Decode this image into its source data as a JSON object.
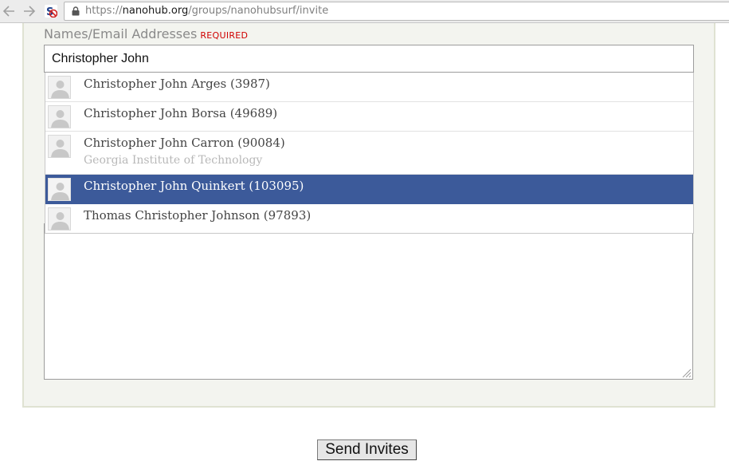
{
  "browser": {
    "url_scheme": "https://",
    "url_host": "nanohub.org",
    "url_path": "/groups/nanohubsurf/invite"
  },
  "form": {
    "label": "Names/Email Addresses",
    "required_label": "REQUIRED",
    "names_value": "Christopher John",
    "submit_label": "Send Invites"
  },
  "suggestions": [
    {
      "name": "Christopher John Arges (3987)",
      "org": "",
      "selected": false
    },
    {
      "name": "Christopher John Borsa (49689)",
      "org": "",
      "selected": false
    },
    {
      "name": "Christopher John Carron (90084)",
      "org": "Georgia Institute of Technology",
      "selected": false
    },
    {
      "name": "Christopher John Quinkert (103095)",
      "org": "",
      "selected": true
    },
    {
      "name": "Thomas Christopher Johnson (97893)",
      "org": "",
      "selected": false
    }
  ],
  "colors": {
    "selected_row": "#3c5a9a",
    "required": "#d00000",
    "fieldset_bg": "#f3f4ef"
  }
}
